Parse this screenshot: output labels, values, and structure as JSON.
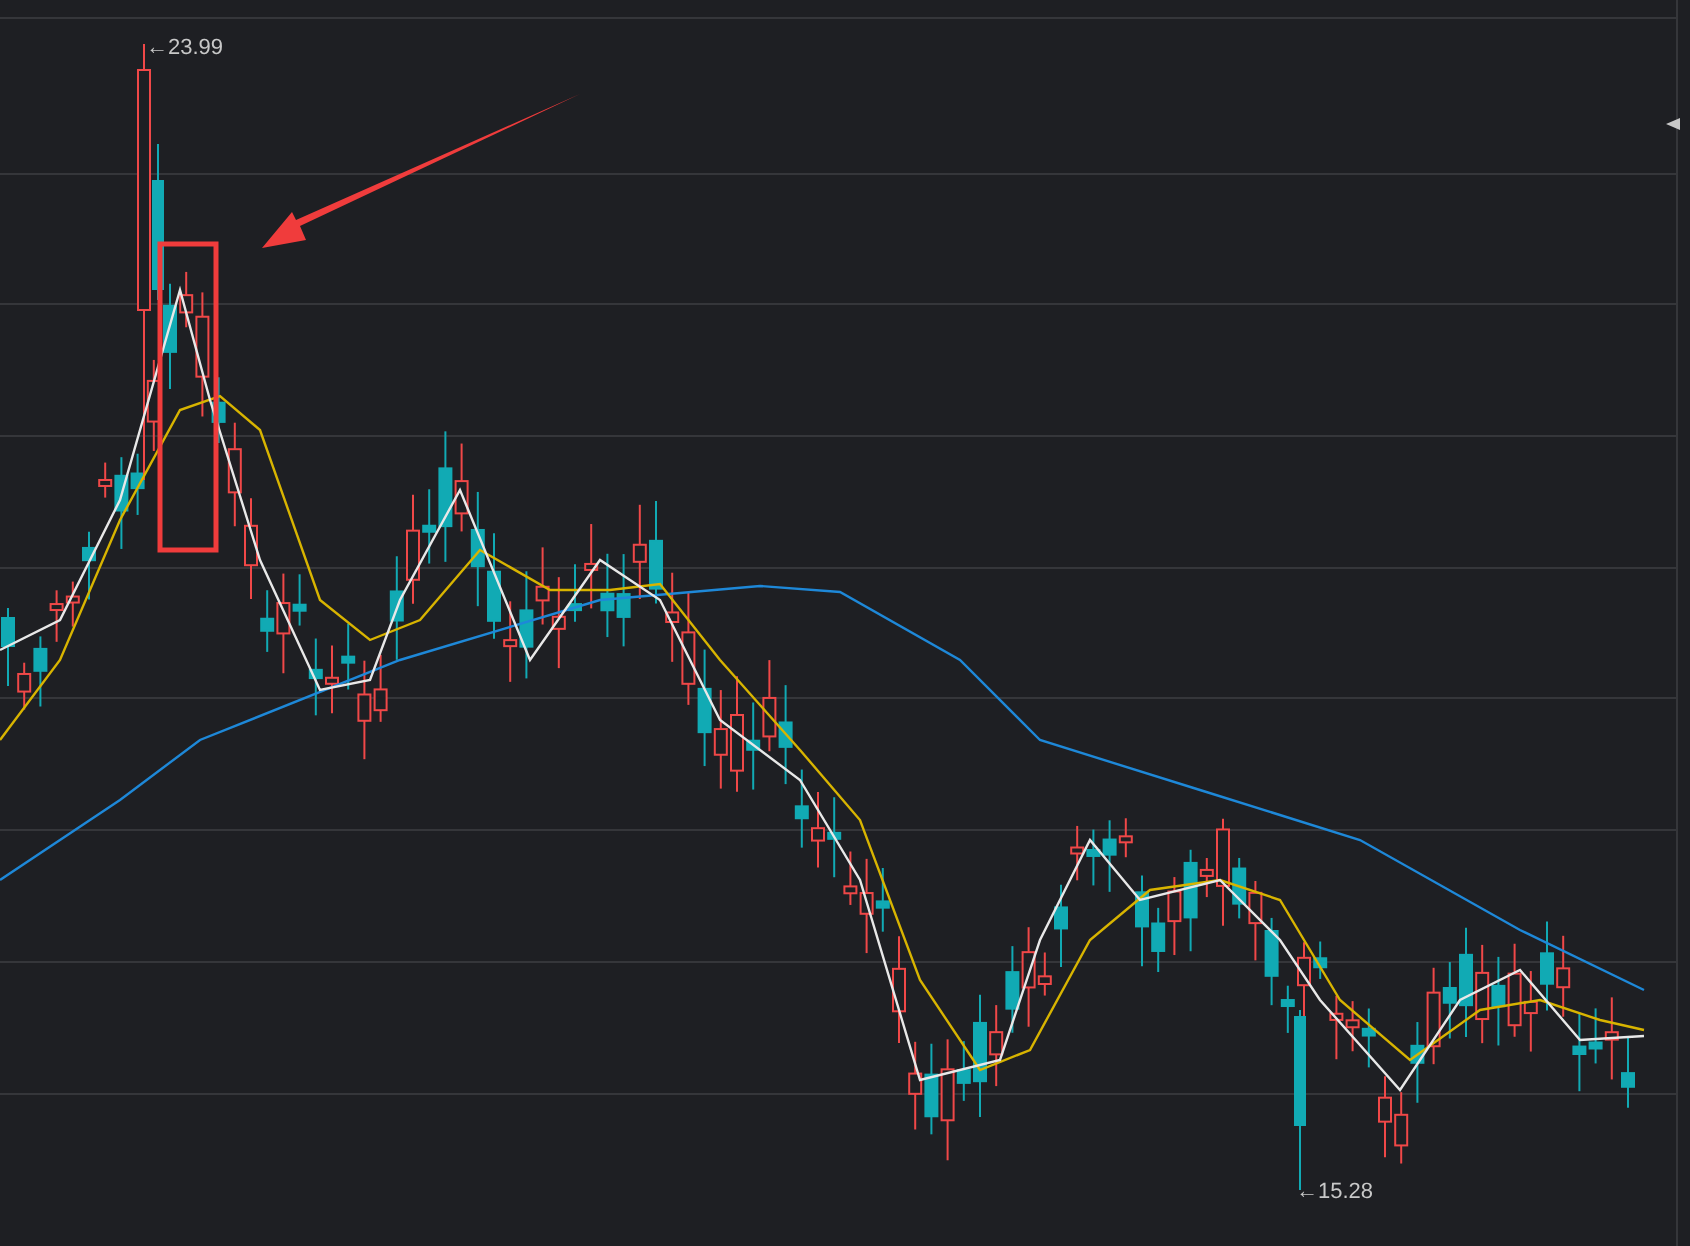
{
  "chart": {
    "high_label": "←23.99",
    "low_label": "←15.28"
  }
}
